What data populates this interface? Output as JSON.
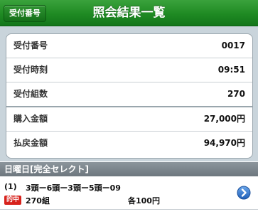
{
  "header": {
    "back_label": "受付番号",
    "title": "照会結果一覧"
  },
  "summary": {
    "rows": [
      {
        "label": "受付番号",
        "value": "0017"
      },
      {
        "label": "受付時刻",
        "value": "09:51"
      },
      {
        "label": "受付組数",
        "value": "270"
      },
      {
        "label": "購入金額",
        "value": "27,000円"
      },
      {
        "label": "払戻金額",
        "value": "94,970円"
      }
    ]
  },
  "section": {
    "title": "日曜日[完全セレクト]"
  },
  "entries": [
    {
      "index": "(1)",
      "combination": "3頭ー6頭ー3頭ー5頭ー09",
      "badge": "的中",
      "count": "270組",
      "amount": "各100円"
    }
  ],
  "colors": {
    "header": "#1f8a23",
    "badge": "#d7221c",
    "chevron": "#2f6fc9"
  },
  "icons": {
    "detail": "chevron-right-icon"
  }
}
